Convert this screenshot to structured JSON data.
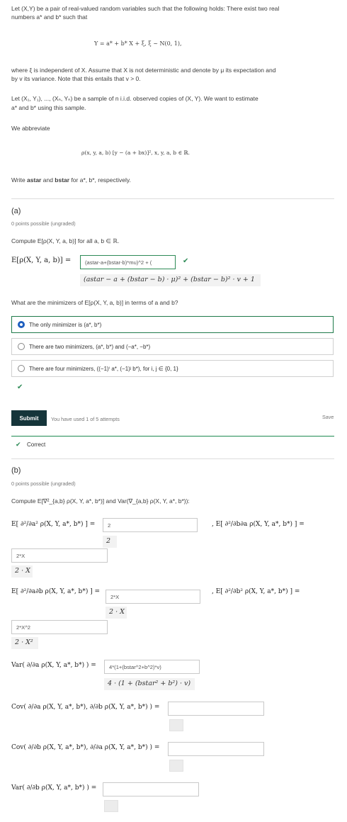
{
  "intro": {
    "line1": "Let (X,Y) be a pair of real-valued random variables such that the following holds: There exist two real",
    "line2": "numbers a* and b* such that",
    "model": "Y = a* + b* X + ξ,   ξ ~ N(0, 1),",
    "where1": "where ξ is independent of X. Assume that X is not deterministic and denote by μ its expectation and",
    "where2": "by v its variance. Note that this entails that v > 0.",
    "sample1": "Let (X₁, Y₁), ..., (Xₙ, Yₙ) be a sample of n i.i.d. observed copies of (X, Y). We want to estimate",
    "sample2": "a* and b* using this sample.",
    "abbrev": "We abbreviate",
    "rho": "ρ(x, y, a, b)   [y − (a + bx)]²,   x, y, a, b ∈ ℝ.",
    "write_prefix": "Write ",
    "write_astar": "astar",
    "write_and": " and ",
    "write_bstar": "bstar",
    "write_suffix": " for a*, b*, respectively."
  },
  "part_a": {
    "heading": "(a)",
    "points": "0 points possible (ungraded)",
    "compute": "Compute E[ρ(X, Y, a, b)] for all a, b ∈ ℝ.",
    "eq_label": "E[ρ(X, Y, a, b)] =",
    "input_value": "(astar-a+(bstar-b)*mu)^2 + (",
    "preview": "(astar − a + (bstar − b) · μ)² + (bstar − b)² · v + 1",
    "question": "What are the minimizers of E[ρ(X, Y, a, b)] in terms of a and b?",
    "options": [
      "The only minimizer is (a*, b*)",
      "There are two minimizers, (a*, b*) and (−a*, −b*)",
      "There are four minimizers, ((−1)ⁱ a*, (−1)ʲ b*), for i, j ∈ {0, 1}"
    ],
    "submit_label": "Submit",
    "attempts": "You have used 1 of 5 attempts",
    "save_label": "Save",
    "status": "Correct"
  },
  "part_b": {
    "heading": "(b)",
    "points": "0 points possible (ungraded)",
    "compute": "Compute E[∇²_{a,b} ρ(X, Y, a*, b*)] and Var(∇_{a,b} ρ(X, Y, a*, b*)):",
    "e_aa_label": "E[ ∂²/∂a² ρ(X, Y, a*, b*) ] =",
    "e_aa_value": "2",
    "e_aa_preview": "2",
    "e_ba_label": ", E[ ∂²/∂b∂a ρ(X, Y, a*, b*) ] =",
    "e_ba_value": "2*X",
    "e_ba_preview": "2 · X",
    "e_ab_label": "E[ ∂²/∂a∂b ρ(X, Y, a*, b*) ] =",
    "e_ab_value": "2*X",
    "e_ab_preview": "2 · X",
    "e_bb_label": ", E[ ∂²/∂b² ρ(X, Y, a*, b*) ] =",
    "e_bb_value": "2*X^2",
    "e_bb_preview": "2 · X²",
    "var_a_label": "Var( ∂/∂a ρ(X, Y, a*, b*) ) =",
    "var_a_value": "4*(1+(bstar^2+b^2)*v)",
    "var_a_preview": "4 · (1 + (bstar² + b²) · v)",
    "cov_ab_label": "Cov( ∂/∂a ρ(X, Y, a*, b*), ∂/∂b ρ(X, Y, a*, b*) ) =",
    "cov_ba_label": "Cov( ∂/∂b ρ(X, Y, a*, b*), ∂/∂a ρ(X, Y, a*, b*) ) =",
    "var_b_label": "Var( ∂/∂b ρ(X, Y, a*, b*) ) ="
  },
  "colors": {
    "accent_green": "#2e8b57",
    "button_bg": "#15353a",
    "radio_blue": "#1f5fbf"
  },
  "icons": {
    "check": "check-icon",
    "radio_selected": "radio-selected-icon",
    "radio_empty": "radio-empty-icon"
  }
}
